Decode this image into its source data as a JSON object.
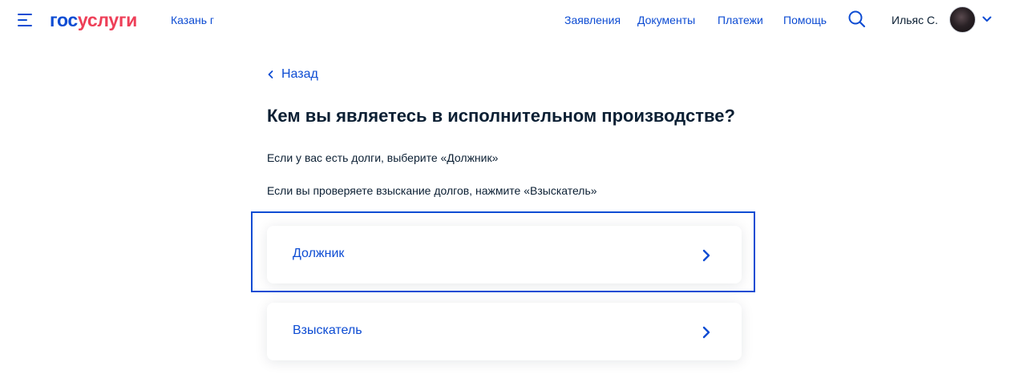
{
  "header": {
    "logo": {
      "part1": "гос",
      "part2": "услуги"
    },
    "location": "Казань г",
    "nav": [
      "Заявления",
      "Документы",
      "Платежи",
      "Помощь"
    ],
    "user_name": "Ильяс С."
  },
  "main": {
    "back_label": "Назад",
    "title": "Кем вы являетесь в исполнительном производстве?",
    "hints": [
      "Если у вас есть долги, выберите «Должник»",
      "Если вы проверяете взыскание долгов, нажмите «Взыскатель»"
    ],
    "options": [
      {
        "label": "Должник"
      },
      {
        "label": "Взыскатель"
      }
    ]
  },
  "colors": {
    "accent": "#0d4cd3",
    "brand_red": "#ee3f58",
    "text": "#0b1f33"
  },
  "icons": [
    "menu-icon",
    "search-icon",
    "chevron-down-icon",
    "chevron-left-icon",
    "chevron-right-icon"
  ]
}
